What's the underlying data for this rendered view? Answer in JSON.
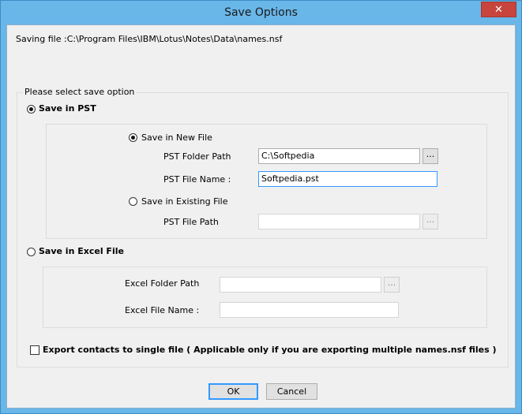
{
  "window": {
    "title": "Save Options",
    "close_glyph": "✕"
  },
  "saving_file": {
    "label": "Saving file :C:\\Program Files\\IBM\\Lotus\\Notes\\Data\\names.nsf"
  },
  "group": {
    "legend": "Please select save option"
  },
  "pst": {
    "radio_label": "Save in PST",
    "new_file": {
      "radio_label": "Save in New File",
      "folder_label": "PST Folder Path",
      "folder_value": "C:\\Softpedia",
      "file_name_label": "PST File Name :",
      "file_name_value": "Softpedia.pst",
      "browse_label": "..."
    },
    "existing_file": {
      "radio_label": "Save in Existing File",
      "path_label": "PST File Path",
      "path_value": "",
      "browse_label": "..."
    }
  },
  "excel": {
    "radio_label": "Save in Excel File",
    "folder_label": "Excel Folder Path",
    "folder_value": "",
    "browse_label": "...",
    "file_name_label": "Excel File Name :",
    "file_name_value": ""
  },
  "export_contacts": {
    "label": "Export contacts to single file ( Applicable only if you are exporting multiple names.nsf files )",
    "checked": false
  },
  "buttons": {
    "ok": "OK",
    "cancel": "Cancel"
  },
  "colors": {
    "title_bar": "#69b6e8",
    "close_button": "#c7453c",
    "focus_border": "#3399ff"
  }
}
